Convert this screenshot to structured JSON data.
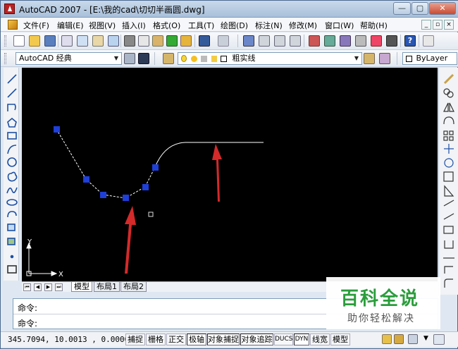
{
  "window": {
    "title": "AutoCAD 2007 - [E:\\我的cad\\切切半画圆.dwg]",
    "buttons": [
      "—",
      "▢",
      "✕"
    ],
    "mdi_buttons": [
      "_",
      "▫",
      "×"
    ]
  },
  "menu": {
    "items": [
      "文件(F)",
      "编辑(E)",
      "视图(V)",
      "插入(I)",
      "格式(O)",
      "工具(T)",
      "绘图(D)",
      "标注(N)",
      "修改(M)",
      "窗口(W)",
      "帮助(H)"
    ]
  },
  "toolbar": {
    "workspace": "AutoCAD 经典",
    "layer": "粗实线",
    "linetype": "ByLayer"
  },
  "drawing": {
    "background_color": "#000000",
    "grip_color": "#1e3fd8",
    "arrow_color": "#d42a2a",
    "line_color": "#ffffff",
    "ucs_y": "Y",
    "ucs_x": "X"
  },
  "tabs": {
    "nav": [
      "⏮",
      "◀",
      "▶",
      "⏭"
    ],
    "items": [
      "模型",
      "布局1",
      "布局2"
    ]
  },
  "command": {
    "line1": "命令:",
    "line2": "命令:"
  },
  "status": {
    "coords": "345.7094, 10.0013 , 0.0000",
    "toggles": [
      "捕捉",
      "栅格",
      "正交",
      "极轴",
      "对象捕捉",
      "对象追踪",
      "DUCS",
      "DYN",
      "线宽",
      "模型"
    ]
  },
  "watermark": {
    "title": "百科全说",
    "subtitle": "助你轻松解决"
  }
}
